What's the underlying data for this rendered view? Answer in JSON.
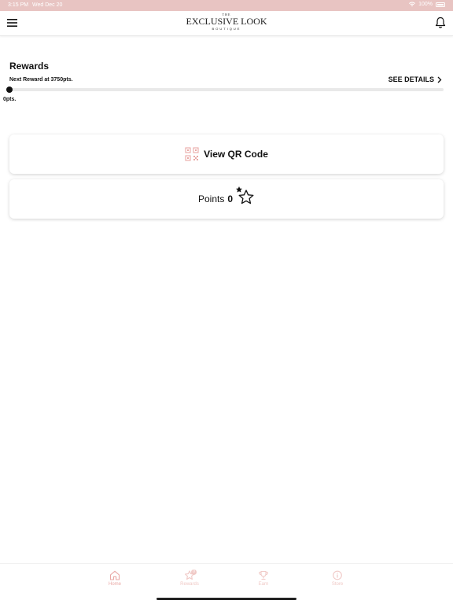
{
  "status_bar": {
    "time": "3:15 PM",
    "date": "Wed Dec 20",
    "battery": "100%"
  },
  "header": {
    "logo": {
      "top": "THE",
      "main": "EXCLUSIVE LOOK",
      "sub": "BOUTIQUE"
    }
  },
  "rewards": {
    "title": "Rewards",
    "next_reward": "Next Reward at 3750pts.",
    "see_details": "SEE DETAILS",
    "progress_label": "0pts.",
    "progress_fraction": 0
  },
  "cards": {
    "qr_label": "View QR Code",
    "points_label": "Points",
    "points_value": "0"
  },
  "tab_bar": {
    "tabs": [
      {
        "label": "Home",
        "icon": "home-icon",
        "active": true
      },
      {
        "label": "Rewards",
        "icon": "star-icon",
        "active": false,
        "badge": "0"
      },
      {
        "label": "Earn",
        "icon": "trophy-icon",
        "active": false
      },
      {
        "label": "Store",
        "icon": "info-icon",
        "active": false
      }
    ]
  },
  "colors": {
    "accent": "#e9a8a5",
    "status_bar": "#e8c4c2",
    "text": "#111111"
  }
}
